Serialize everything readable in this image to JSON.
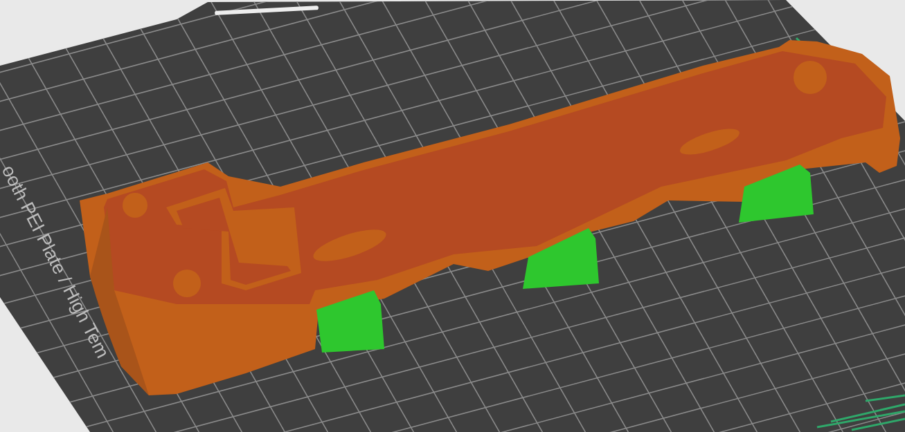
{
  "viewport": {
    "bed_label": "ooth PEI Plate / High Tem"
  }
}
